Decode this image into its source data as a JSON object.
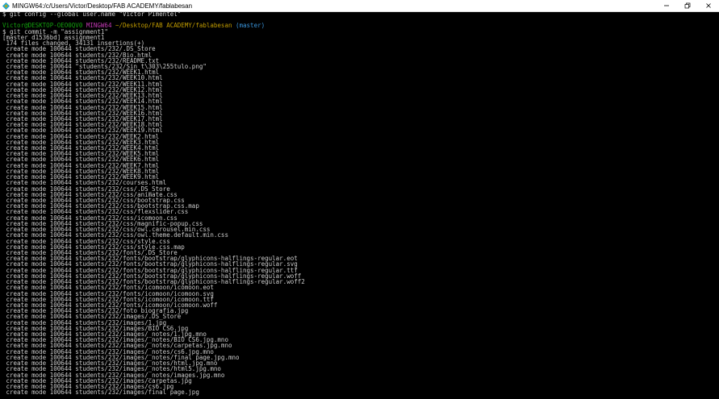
{
  "window": {
    "title": "MINGW64:/c/Users/Victor/Desktop/FAB ACADEMY/fablabesan",
    "controls": {
      "minimize_icon": "minimize-icon",
      "restore_icon": "restore-icon",
      "close_icon": "close-icon"
    }
  },
  "colors": {
    "background": "#000000",
    "text": "#cccccc",
    "user": "#13a10e",
    "mingw": "#c239b3",
    "path": "#c19c00",
    "branch": "#3a96dd"
  },
  "terminal": {
    "first_command": "$ git config --global user.name \"Victor Pimentel\"",
    "prompt": {
      "user": "Victor@DESKTOP-OEO0QV0",
      "env": "MINGW64",
      "path": "~/Desktop/FAB ACADEMY/fablabesan",
      "branch": "(master)"
    },
    "second_command": "$ git commit -m \"assignment1\"",
    "commit_header": "[master d1536bd] assignment1",
    "summary": " 174 files changed, 34131 insertions(+)",
    "lines": [
      " create mode 100644 students/232/.DS_Store",
      " create mode 100644 students/232/Bio.html",
      " create mode 100644 students/232/README.txt",
      " create mode 100644 \"students/232/Sin t\\303\\255tulo.png\"",
      " create mode 100644 students/232/WEEK1.html",
      " create mode 100644 students/232/WEEK10.html",
      " create mode 100644 students/232/WEEK11.html",
      " create mode 100644 students/232/WEEK12.html",
      " create mode 100644 students/232/WEEK13.html",
      " create mode 100644 students/232/WEEK14.html",
      " create mode 100644 students/232/WEEK15.html",
      " create mode 100644 students/232/WEEK16.html",
      " create mode 100644 students/232/WEEK17.html",
      " create mode 100644 students/232/WEEK18.html",
      " create mode 100644 students/232/WEEK19.html",
      " create mode 100644 students/232/WEEK2.html",
      " create mode 100644 students/232/WEEK3.html",
      " create mode 100644 students/232/WEEK4.html",
      " create mode 100644 students/232/WEEK5.html",
      " create mode 100644 students/232/WEEK6.html",
      " create mode 100644 students/232/WEEK7.html",
      " create mode 100644 students/232/WEEK8.html",
      " create mode 100644 students/232/WEEK9.html",
      " create mode 100644 students/232/courses.html",
      " create mode 100644 students/232/css/.DS_Store",
      " create mode 100644 students/232/css/animate.css",
      " create mode 100644 students/232/css/bootstrap.css",
      " create mode 100644 students/232/css/bootstrap.css.map",
      " create mode 100644 students/232/css/flexslider.css",
      " create mode 100644 students/232/css/icomoon.css",
      " create mode 100644 students/232/css/magnific-popup.css",
      " create mode 100644 students/232/css/owl.carousel.min.css",
      " create mode 100644 students/232/css/owl.theme.default.min.css",
      " create mode 100644 students/232/css/style.css",
      " create mode 100644 students/232/css/style.css.map",
      " create mode 100644 students/232/fonts/.DS_Store",
      " create mode 100644 students/232/fonts/bootstrap/glyphicons-halflings-regular.eot",
      " create mode 100644 students/232/fonts/bootstrap/glyphicons-halflings-regular.svg",
      " create mode 100644 students/232/fonts/bootstrap/glyphicons-halflings-regular.ttf",
      " create mode 100644 students/232/fonts/bootstrap/glyphicons-halflings-regular.woff",
      " create mode 100644 students/232/fonts/bootstrap/glyphicons-halflings-regular.woff2",
      " create mode 100644 students/232/fonts/icomoon/icomoon.eot",
      " create mode 100644 students/232/fonts/icomoon/icomoon.svg",
      " create mode 100644 students/232/fonts/icomoon/icomoon.ttf",
      " create mode 100644 students/232/fonts/icomoon/icomoon.woff",
      " create mode 100644 students/232/foto biografia.jpg",
      " create mode 100644 students/232/images/.DS_Store",
      " create mode 100644 students/232/images/1.jpg",
      " create mode 100644 students/232/images/BIO CS6.jpg",
      " create mode 100644 students/232/images/_notes/1.jpg.mno",
      " create mode 100644 students/232/images/_notes/BIO CS6.jpg.mno",
      " create mode 100644 students/232/images/_notes/carpetas.jpg.mno",
      " create mode 100644 students/232/images/_notes/cs6.jpg.mno",
      " create mode 100644 students/232/images/_notes/final page.jpg.mno",
      " create mode 100644 students/232/images/_notes/html.jpg.mno",
      " create mode 100644 students/232/images/_notes/html5.jpg.mno",
      " create mode 100644 students/232/images/_notes/images.jpg.mno",
      " create mode 100644 students/232/images/carpetas.jpg",
      " create mode 100644 students/232/images/cs6.jpg",
      " create mode 100644 students/232/images/final page.jpg"
    ]
  }
}
